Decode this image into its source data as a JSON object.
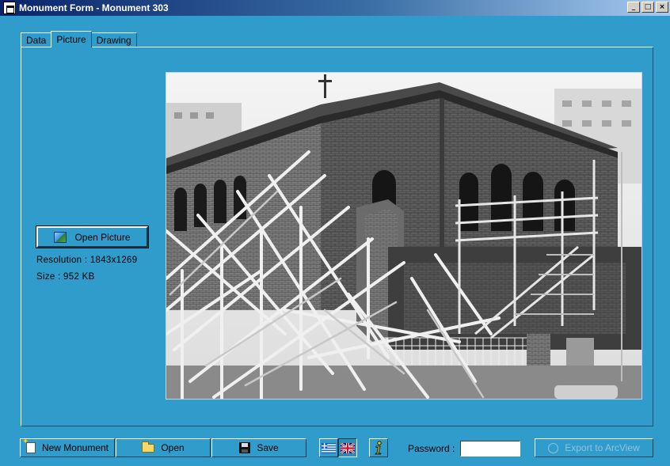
{
  "window": {
    "title": "Monument Form - Monument 303",
    "minimize": "_",
    "maximize": "□",
    "close": "×"
  },
  "tabs": [
    {
      "label": "Data",
      "active": false
    },
    {
      "label": "Picture",
      "active": true
    },
    {
      "label": "Drawing",
      "active": false
    }
  ],
  "picture": {
    "open_button_label": "Open Picture",
    "resolution": "Resolution : 1843x1269",
    "size": "Size : 952 KB"
  },
  "toolbar": {
    "new_label": "New Monument",
    "open_label": "Open",
    "save_label": "Save",
    "password_label": "Password :",
    "password_value": "",
    "export_label": "Export to ArcView"
  },
  "icons": {
    "new": "new-document-icon",
    "open": "folder-icon",
    "save": "floppy-disk-icon",
    "greek": "greek-flag-icon",
    "english": "uk-flag-icon",
    "info": "info-icon",
    "export": "globe-icon"
  },
  "colors": {
    "background": "#2f9ccb",
    "titlebar": "#0a246a"
  }
}
